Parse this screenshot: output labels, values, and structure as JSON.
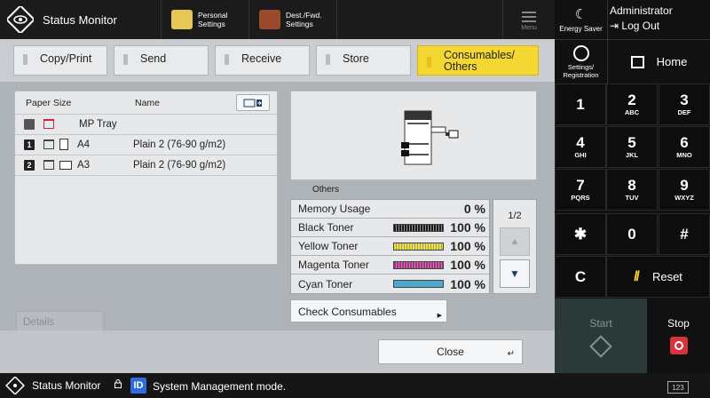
{
  "topbar": {
    "title": "Status Monitor",
    "personal_settings": "Personal\nSettings",
    "personal_settings_l1": "Personal",
    "personal_settings_l2": "Settings",
    "dest_fwd_l1": "Dest./Fwd.",
    "dest_fwd_l2": "Settings",
    "menu_label": "Menu"
  },
  "tabs": [
    {
      "label": "Copy/Print"
    },
    {
      "label": "Send"
    },
    {
      "label": "Receive"
    },
    {
      "label": "Store"
    },
    {
      "label_l1": "Consumables/",
      "label_l2": "Others",
      "active": true
    }
  ],
  "paper": {
    "header_size": "Paper Size",
    "header_name": "Name",
    "rows": [
      {
        "badge": "",
        "size": "MP Tray",
        "name": ""
      },
      {
        "badge": "1",
        "size": "A4",
        "name": "Plain 2 (76-90 g/m2)"
      },
      {
        "badge": "2",
        "size": "A3",
        "name": "Plain 2 (76-90 g/m2)"
      }
    ],
    "details_label": "Details"
  },
  "others": {
    "label": "Others",
    "items": [
      {
        "name": "Memory Usage",
        "value": "0 %",
        "bar": false,
        "color": ""
      },
      {
        "name": "Black Toner",
        "value": "100 %",
        "bar": true,
        "color": "#1a1a1a"
      },
      {
        "name": "Yellow Toner",
        "value": "100 %",
        "bar": true,
        "color": "#f1e12a"
      },
      {
        "name": "Magenta Toner",
        "value": "100 %",
        "bar": true,
        "color": "#c0258f"
      },
      {
        "name": "Cyan Toner",
        "value": "100 %",
        "bar": true,
        "color": "#2bb0e6"
      }
    ],
    "page_indicator": "1/2",
    "check_consumables": "Check Consumables"
  },
  "close_label": "Close",
  "statusbar": {
    "title": "Status Monitor",
    "id_badge": "ID",
    "mode": "System Management mode.",
    "counter_icon": "123"
  },
  "right_panel": {
    "energy_saver": "Energy Saver",
    "admin_name": "Administrator",
    "logout": "Log Out",
    "settings_reg_l1": "Settings/",
    "settings_reg_l2": "Registration",
    "home": "Home",
    "keys": [
      {
        "d": "1",
        "s": ""
      },
      {
        "d": "2",
        "s": "ABC"
      },
      {
        "d": "3",
        "s": "DEF"
      },
      {
        "d": "4",
        "s": "GHI"
      },
      {
        "d": "5",
        "s": "JKL"
      },
      {
        "d": "6",
        "s": "MNO"
      },
      {
        "d": "7",
        "s": "PQRS"
      },
      {
        "d": "8",
        "s": "TUV"
      },
      {
        "d": "9",
        "s": "WXYZ"
      },
      {
        "d": "✱",
        "s": ""
      },
      {
        "d": "0",
        "s": ""
      },
      {
        "d": "#",
        "s": ""
      },
      {
        "d": "C",
        "s": ""
      }
    ],
    "reset": "Reset",
    "start": "Start",
    "stop": "Stop"
  },
  "colors": {
    "active_tab": "#f4d732",
    "id_badge": "#2d6de0",
    "stop": "#d8333a"
  }
}
